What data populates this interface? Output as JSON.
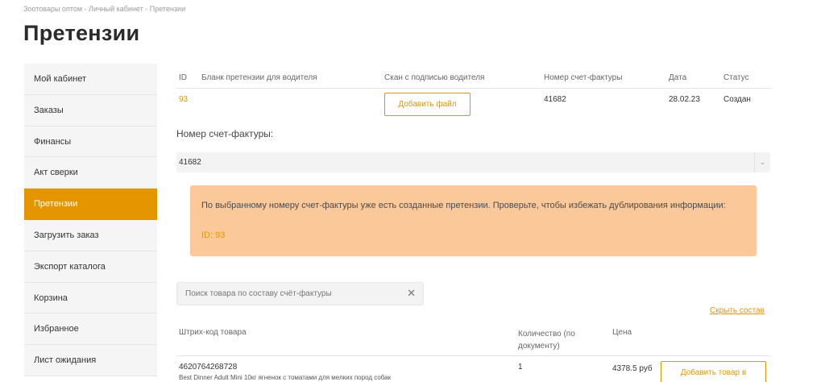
{
  "breadcrumb": {
    "items": [
      "Зоотовары оптом",
      "Личный кабинет",
      "Претензии"
    ],
    "separator": " - "
  },
  "page_title": "Претензии",
  "sidebar": {
    "items": [
      {
        "label": "Мой кабинет",
        "active": false
      },
      {
        "label": "Заказы",
        "active": false
      },
      {
        "label": "Финансы",
        "active": false
      },
      {
        "label": "Акт сверки",
        "active": false
      },
      {
        "label": "Претензии",
        "active": true
      },
      {
        "label": "Загрузить заказ",
        "active": false
      },
      {
        "label": "Экспорт каталога",
        "active": false
      },
      {
        "label": "Корзина",
        "active": false
      },
      {
        "label": "Избранное",
        "active": false
      },
      {
        "label": "Лист ожидания",
        "active": false
      }
    ],
    "active_color": "#e59500"
  },
  "claims_table": {
    "headers": {
      "id": "ID",
      "blank": "Бланк претензии для водителя",
      "scan": "Скан с подписью водителя",
      "invoice": "Номер счет-фактуры",
      "date": "Дата",
      "status": "Статус"
    },
    "row": {
      "id": "93",
      "add_file_label": "Добавить файл",
      "invoice": "41682",
      "date": "28.02.23",
      "status": "Создан"
    }
  },
  "invoice_select": {
    "label": "Номер счет-фактуры:",
    "value": "41682",
    "arrow_icon": "chevron-down-icon"
  },
  "warning": {
    "text": "По выбранному номеру счет-фактуры уже есть созданные претензии. Проверьте, чтобы избежать дублирования информации:",
    "link": "ID: 93",
    "background": "#fbc999"
  },
  "search": {
    "placeholder": "Поиск товара по составу счёт-фактуры",
    "value": "",
    "clear_icon": "close-icon"
  },
  "hide_link": "Скрыть состав",
  "goods_table": {
    "headers": {
      "code": "Штрих-код товара",
      "qty": "Количество (по документу)",
      "price": "Цена"
    },
    "rows": [
      {
        "code": "4620764268728",
        "name": "Best Dinner Adult Mini 10кг ягненок с томатами для мелких пород собак",
        "qty": "1",
        "price": "4378.5 руб",
        "add_label": "Добавить товар в"
      }
    ]
  },
  "colors": {
    "accent": "#e59500",
    "text": "#333333",
    "muted": "#666666"
  }
}
